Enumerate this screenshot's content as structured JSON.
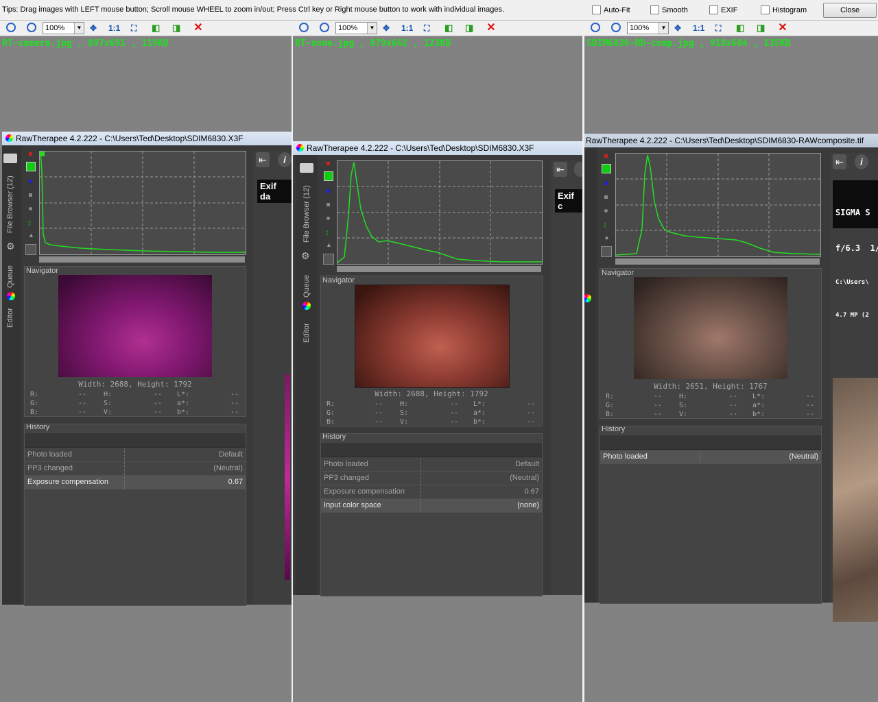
{
  "topbar": {
    "tips": "Tips: Drag images with LEFT mouse button; Scroll mouse WHEEL to zoom in/out; Press Ctrl key or Right mouse button to work with individual images.",
    "checkboxes": [
      "Auto-Fit",
      "Smooth",
      "EXIF",
      "Histogram"
    ],
    "close_label": "Close"
  },
  "toolbar": {
    "zoom_value": "100%",
    "one_to_one": "1:1"
  },
  "panes": [
    {
      "filename": "RT-camera.jpg  ,  897x691  ,  119KB",
      "window_title": "RawTherapee 4.2.222 - C:\\Users\\Ted\\Desktop\\SDIM6830.X3F",
      "tabs": {
        "file_browser": "File Browser (12)",
        "queue": "Queue",
        "editor": "Editor"
      },
      "navigator_label": "Navigator",
      "dimensions": "Width: 2688, Height: 1792",
      "history_label": "History",
      "history": [
        {
          "name": "Photo loaded",
          "value": "Default",
          "selected": false
        },
        {
          "name": "PP3 changed",
          "value": "(Neutral)",
          "selected": false
        },
        {
          "name": "Exposure compensation",
          "value": "0.67",
          "selected": true
        }
      ],
      "exif_label": "Exif da"
    },
    {
      "filename": "RT-none.jpg  ,  879x662  ,  123KB",
      "window_title": "RawTherapee 4.2.222 - C:\\Users\\Ted\\Desktop\\SDIM6830.X3F",
      "tabs": {
        "file_browser": "File Browser (12)",
        "queue": "Queue",
        "editor": "Editor"
      },
      "navigator_label": "Navigator",
      "dimensions": "Width: 2688, Height: 1792",
      "history_label": "History",
      "history": [
        {
          "name": "Photo loaded",
          "value": "Default",
          "selected": false
        },
        {
          "name": "PP3 changed",
          "value": "(Neutral)",
          "selected": false
        },
        {
          "name": "Exposure compensation",
          "value": "0.67",
          "selected": false
        },
        {
          "name": "Input color space",
          "value": "(none)",
          "selected": true
        }
      ],
      "exif_label": "Exif c"
    },
    {
      "filename": "SDIM6830-RD-comp.jpg  ,  918x684  ,  135KB",
      "window_title": "RawTherapee 4.2.222 - C:\\Users\\Ted\\Desktop\\SDIM6830-RAWcomposite.tif",
      "tabs": {
        "file_browser": "File Browser (12)",
        "queue": "Queue",
        "editor": "Editor"
      },
      "navigator_label": "Navigator",
      "dimensions": "Width: 2651, Height: 1767",
      "history_label": "History",
      "history": [
        {
          "name": "Photo loaded",
          "value": "(Neutral)",
          "selected": true
        }
      ],
      "info_lines": [
        "SIGMA S",
        "f/6.3  1/",
        "C:\\Users\\",
        "4.7 MP (2"
      ]
    }
  ],
  "pixel_values": {
    "labels": [
      [
        "R:",
        "H:",
        "L*:"
      ],
      [
        "G:",
        "S:",
        "a*:"
      ],
      [
        "B:",
        "V:",
        "b*:"
      ]
    ],
    "empty": "--"
  },
  "colors": {
    "filename_green": "#1fe01f",
    "histogram_green": "#22dd22",
    "close_red": "#e01010"
  }
}
